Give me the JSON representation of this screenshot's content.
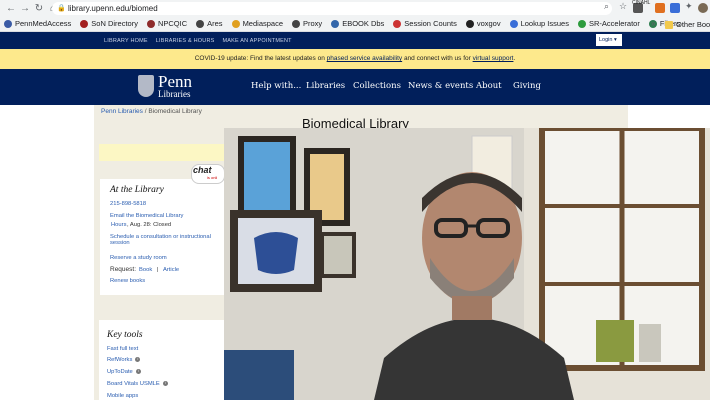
{
  "browser": {
    "url": "library.upenn.edu/biomed",
    "bookmarks": [
      {
        "label": "PennMedAccess",
        "color": "#3b5ba5"
      },
      {
        "label": "SoN Directory",
        "color": "#a32020"
      },
      {
        "label": "NPCQIC",
        "color": "#8e2b2b"
      },
      {
        "label": "Ares",
        "color": "#444"
      },
      {
        "label": "Mediaspace",
        "color": "#e0a020"
      },
      {
        "label": "Proxy",
        "color": "#444"
      },
      {
        "label": "EBOOK Dbs",
        "color": "#3366aa"
      },
      {
        "label": "Session Counts",
        "color": "#cc3333"
      },
      {
        "label": "voxgov",
        "color": "#222"
      },
      {
        "label": "Lookup Issues",
        "color": "#3a6ed8"
      },
      {
        "label": "SR-Accelerator",
        "color": "#2d9b3d"
      },
      {
        "label": "Filters",
        "color": "#2d7d4e"
      }
    ],
    "overflow": "»",
    "other_bookmarks": "Other Bookm",
    "ext_badge": "CINAHL"
  },
  "utility_nav": {
    "links": [
      "LIBRARY HOME",
      "LIBRARIES & HOURS",
      "MAKE AN APPOINTMENT"
    ],
    "login": "Login ▾"
  },
  "alert": {
    "prefix": "COVID-19 update: Find the latest updates on ",
    "link1": "phased service availability",
    "middle": " and connect with us for ",
    "link2": "virtual support",
    "suffix": "."
  },
  "site": {
    "logo_penn": "Penn",
    "logo_libraries": "Libraries",
    "menu": [
      "Help with...",
      "Libraries",
      "Collections",
      "News & events",
      "About",
      "Giving"
    ]
  },
  "breadcrumb": {
    "home": "Penn Libraries",
    "sep": "/",
    "current": "Biomedical Library"
  },
  "page_title": "Biomedical Library",
  "chat": {
    "label": "chat",
    "status": "is onli"
  },
  "at_library": {
    "heading": "At the Library",
    "phone": "215-898-5818",
    "email": "Email the Biomedical Library",
    "hours_link": "Hours",
    "hours_text": ", Aug. 28: Closed",
    "schedule": "Schedule a consultation or instructional session",
    "reserve": "Reserve a study room",
    "request_label": "Request:",
    "request_book": "Book",
    "request_sep": "|",
    "request_article": "Article",
    "renew": "Renew books"
  },
  "key_tools": {
    "heading": "Key tools",
    "items": [
      "Fast full text",
      "RefWorks",
      "UpToDate",
      "Board Vitals USMLE",
      "Mobile apps"
    ]
  },
  "colors": {
    "penn_blue": "#011f5b",
    "alert_yellow": "#fde98c",
    "link": "#2a5db0"
  }
}
